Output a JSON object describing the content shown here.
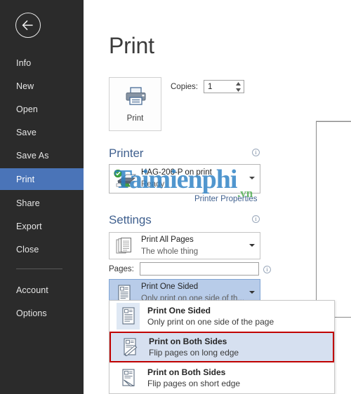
{
  "sidebar": {
    "back_icon": "back-arrow-icon",
    "items": [
      {
        "label": "Info",
        "active": false
      },
      {
        "label": "New",
        "active": false
      },
      {
        "label": "Open",
        "active": false
      },
      {
        "label": "Save",
        "active": false
      },
      {
        "label": "Save As",
        "active": false
      },
      {
        "label": "Print",
        "active": true
      },
      {
        "label": "Share",
        "active": false
      },
      {
        "label": "Export",
        "active": false
      },
      {
        "label": "Close",
        "active": false
      },
      {
        "label": "Account",
        "active": false
      },
      {
        "label": "Options",
        "active": false
      }
    ],
    "active_color": "#4a74b8",
    "background_color": "#2b2b2b"
  },
  "main": {
    "title": "Print",
    "print_button": {
      "label": "Print",
      "icon": "printer-icon"
    },
    "copies": {
      "label": "Copies:",
      "value": "1",
      "spinner_icon": "spinner-updown-icon"
    },
    "printer_section": {
      "heading": "Printer",
      "info_icon": "info-icon",
      "name": "HAG-206-P on print",
      "status": "Ready",
      "status_icon": "printer-ready-check-icon",
      "caret_icon": "chevron-down-icon",
      "properties_link": "Printer Properties"
    },
    "settings_section": {
      "heading": "Settings",
      "info_icon": "info-icon",
      "range_combo": {
        "title": "Print All Pages",
        "subtitle": "The whole thing",
        "icon": "all-pages-icon",
        "caret_icon": "chevron-down-icon"
      },
      "pages": {
        "label": "Pages:",
        "value": "",
        "placeholder": "",
        "info_icon": "info-icon"
      },
      "sides_combo": {
        "title": "Print One Sided",
        "subtitle": "Only print on one side of th...",
        "icon": "one-sided-icon",
        "caret_icon": "chevron-down-icon",
        "selected": true
      }
    }
  },
  "dropdown": {
    "open": true,
    "highlight_color": "#c00000",
    "items": [
      {
        "title": "Print One Sided",
        "subtitle": "Only print on one side of the page",
        "icon": "one-sided-icon",
        "state": "current"
      },
      {
        "title": "Print on Both Sides",
        "subtitle": "Flip pages on long edge",
        "icon": "both-sides-long-edge-icon",
        "state": "highlighted"
      },
      {
        "title": "Print on Both Sides",
        "subtitle": "Flip pages on short edge",
        "icon": "both-sides-short-edge-icon",
        "state": "normal"
      }
    ]
  },
  "watermark": {
    "main": "Taimienphi",
    "suffix": ".vn",
    "main_color": "#2a7fc4",
    "suffix_color": "#3fa63f"
  },
  "preview": {
    "page_label": ""
  }
}
